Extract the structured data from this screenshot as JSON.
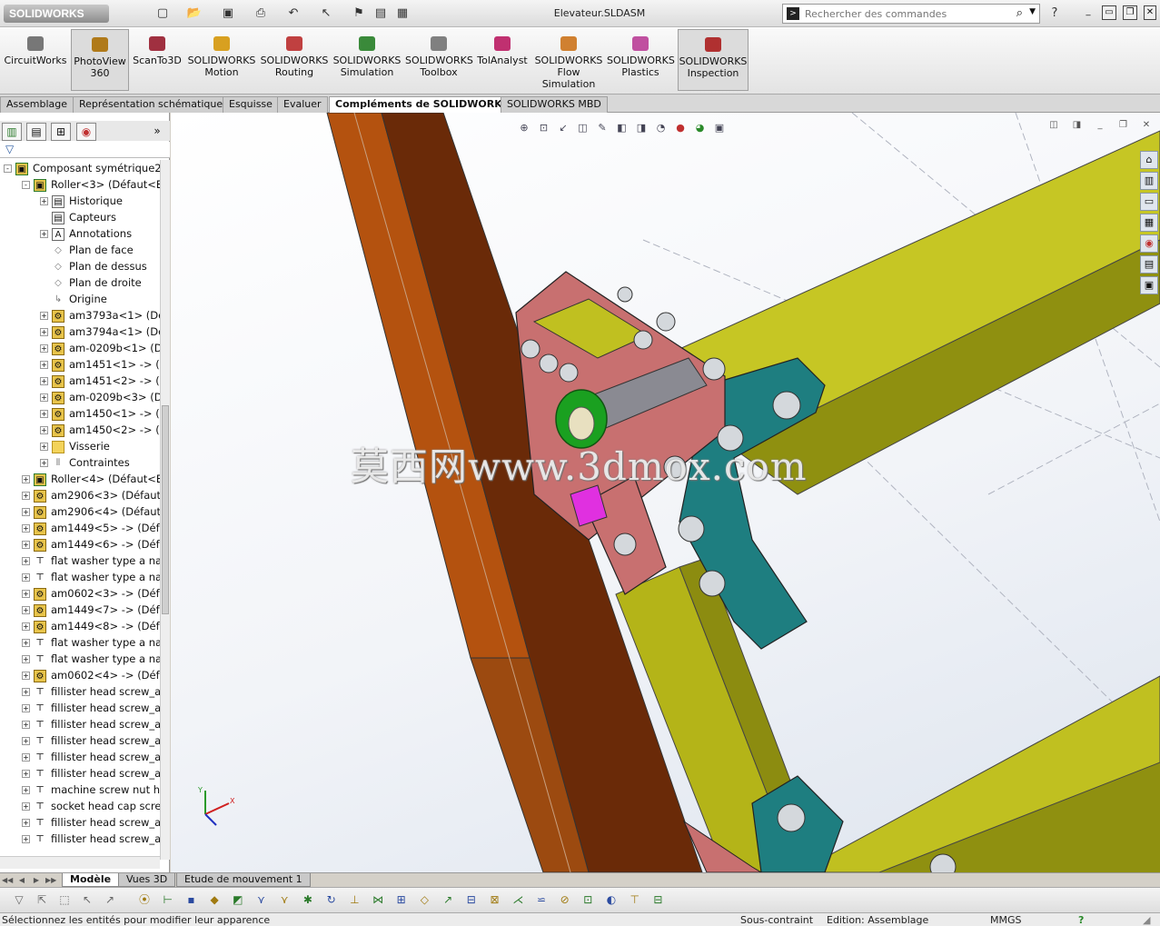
{
  "app": {
    "logo": "SOLIDWORKS",
    "document_title": "Elevateur.SLDASM"
  },
  "search": {
    "placeholder": "Rechercher des commandes"
  },
  "ribbon": [
    {
      "label": "CircuitWorks",
      "color": "#777777"
    },
    {
      "label": "PhotoView\n360",
      "color": "#b07a1a",
      "active": true
    },
    {
      "label": "ScanTo3D",
      "color": "#a03040"
    },
    {
      "label": "SOLIDWORKS\nMotion",
      "color": "#d8a020"
    },
    {
      "label": "SOLIDWORKS\nRouting",
      "color": "#c04040"
    },
    {
      "label": "SOLIDWORKS\nSimulation",
      "color": "#3a8a3a"
    },
    {
      "label": "SOLIDWORKS\nToolbox",
      "color": "#808080"
    },
    {
      "label": "TolAnalyst",
      "color": "#c03070"
    },
    {
      "label": "SOLIDWORKS\nFlow\nSimulation",
      "color": "#d08030"
    },
    {
      "label": "SOLIDWORKS\nPlastics",
      "color": "#c050a0"
    },
    {
      "label": "SOLIDWORKS\nInspection",
      "color": "#b03030",
      "active": true
    }
  ],
  "command_tabs": [
    "Assemblage",
    "Représentation schématique",
    "Esquisse",
    "Evaluer",
    "Compléments de SOLIDWORKS",
    "SOLIDWORKS MBD"
  ],
  "active_command_tab": "Compléments de SOLIDWORKS",
  "tree": [
    {
      "level": 0,
      "icon": "subasm",
      "label": "Composant symétrique2",
      "exp": "-"
    },
    {
      "level": 1,
      "icon": "subasm",
      "label": "Roller<3> (Défaut<Et",
      "exp": "-"
    },
    {
      "level": 2,
      "icon": "hist",
      "label": "Historique",
      "exp": "+"
    },
    {
      "level": 2,
      "icon": "hist",
      "label": "Capteurs",
      "exp": ""
    },
    {
      "level": 2,
      "icon": "annot",
      "label": "Annotations",
      "exp": "+"
    },
    {
      "level": 2,
      "icon": "plane",
      "label": "Plan de face",
      "exp": ""
    },
    {
      "level": 2,
      "icon": "plane",
      "label": "Plan de dessus",
      "exp": ""
    },
    {
      "level": 2,
      "icon": "plane",
      "label": "Plan de droite",
      "exp": ""
    },
    {
      "level": 2,
      "icon": "origin",
      "label": "Origine",
      "exp": ""
    },
    {
      "level": 2,
      "icon": "comp",
      "label": "am3793a<1> (Déf",
      "exp": "+"
    },
    {
      "level": 2,
      "icon": "comp",
      "label": "am3794a<1> (Déf",
      "exp": "+"
    },
    {
      "level": 2,
      "icon": "comp",
      "label": "am-0209b<1> (De",
      "exp": "+"
    },
    {
      "level": 2,
      "icon": "comp",
      "label": "am1451<1> -> (D",
      "exp": "+"
    },
    {
      "level": 2,
      "icon": "comp",
      "label": "am1451<2> -> (D",
      "exp": "+"
    },
    {
      "level": 2,
      "icon": "comp",
      "label": "am-0209b<3> (De",
      "exp": "+"
    },
    {
      "level": 2,
      "icon": "comp",
      "label": "am1450<1> -> (D",
      "exp": "+"
    },
    {
      "level": 2,
      "icon": "comp",
      "label": "am1450<2> -> (D",
      "exp": "+"
    },
    {
      "level": 2,
      "icon": "folder",
      "label": "Visserie",
      "exp": "+"
    },
    {
      "level": 2,
      "icon": "mates",
      "label": "Contraintes",
      "exp": "+"
    },
    {
      "level": 1,
      "icon": "subasm",
      "label": "Roller<4> (Défaut<Et",
      "exp": "+"
    },
    {
      "level": 1,
      "icon": "comp",
      "label": "am2906<3> (Défaut<",
      "exp": "+"
    },
    {
      "level": 1,
      "icon": "comp",
      "label": "am2906<4> (Défaut<",
      "exp": "+"
    },
    {
      "level": 1,
      "icon": "comp",
      "label": "am1449<5> -> (Défa",
      "exp": "+"
    },
    {
      "level": 1,
      "icon": "comp",
      "label": "am1449<6> -> (Défa",
      "exp": "+"
    },
    {
      "level": 1,
      "icon": "screw",
      "label": "flat washer type a nar",
      "exp": "+"
    },
    {
      "level": 1,
      "icon": "screw",
      "label": "flat washer type a nar",
      "exp": "+"
    },
    {
      "level": 1,
      "icon": "comp",
      "label": "am0602<3> -> (Défa",
      "exp": "+"
    },
    {
      "level": 1,
      "icon": "comp",
      "label": "am1449<7> -> (Défa",
      "exp": "+"
    },
    {
      "level": 1,
      "icon": "comp",
      "label": "am1449<8> -> (Défa",
      "exp": "+"
    },
    {
      "level": 1,
      "icon": "screw",
      "label": "flat washer type a nar",
      "exp": "+"
    },
    {
      "level": 1,
      "icon": "screw",
      "label": "flat washer type a nar",
      "exp": "+"
    },
    {
      "level": 1,
      "icon": "comp",
      "label": "am0602<4> -> (Défa",
      "exp": "+"
    },
    {
      "level": 1,
      "icon": "screw",
      "label": "fillister head screw_ai",
      "exp": "+"
    },
    {
      "level": 1,
      "icon": "screw",
      "label": "fillister head screw_ai",
      "exp": "+"
    },
    {
      "level": 1,
      "icon": "screw",
      "label": "fillister head screw_ai",
      "exp": "+"
    },
    {
      "level": 1,
      "icon": "screw",
      "label": "fillister head screw_ai",
      "exp": "+"
    },
    {
      "level": 1,
      "icon": "screw",
      "label": "fillister head screw_ai",
      "exp": "+"
    },
    {
      "level": 1,
      "icon": "screw",
      "label": "fillister head screw_ai",
      "exp": "+"
    },
    {
      "level": 1,
      "icon": "screw",
      "label": "machine screw nut h",
      "exp": "+"
    },
    {
      "level": 1,
      "icon": "screw",
      "label": "socket head cap scre",
      "exp": "+"
    },
    {
      "level": 1,
      "icon": "screw",
      "label": "fillister head screw_ai",
      "exp": "+"
    },
    {
      "level": 1,
      "icon": "screw",
      "label": "fillister head screw_ai",
      "exp": "+"
    }
  ],
  "watermark": "莫西网www.3dmox.com",
  "triad": {
    "x": "X",
    "y": "Y"
  },
  "bottom_tabs": [
    "Modèle",
    "Vues 3D",
    "Etude de mouvement 1"
  ],
  "active_bottom_tab": "Modèle",
  "status": {
    "message": "Sélectionnez les entités pour modifier leur apparence",
    "state": "Sous-contraint",
    "edition": "Edition: Assemblage",
    "units": "MMGS"
  },
  "colors": {
    "beam_orange": "#a04a10",
    "beam_yellow": "#b8b818",
    "plate_teal": "#1a7a7a",
    "plate_pink": "#c46a6a"
  }
}
